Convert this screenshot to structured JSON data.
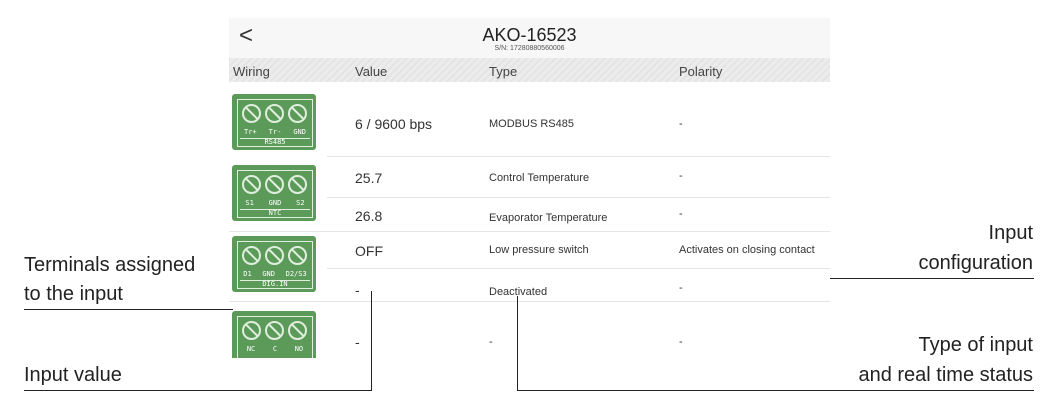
{
  "device": {
    "back_icon": "chevron-left-icon",
    "back_glyph": "<",
    "name": "AKO-16523",
    "serial": "S/N: 17280880560006"
  },
  "columns": [
    "Wiring",
    "Value",
    "Type",
    "Polarity"
  ],
  "terminals": [
    {
      "labels": [
        "Tr+",
        "Tr-",
        "GND"
      ],
      "name": "RS485"
    },
    {
      "labels": [
        "S1",
        "GND",
        "S2"
      ],
      "name": "NTC"
    },
    {
      "labels": [
        "D1",
        "GND",
        "D2/S3"
      ],
      "name": "DIG.IN"
    },
    {
      "labels": [
        "NC",
        "C",
        "NO"
      ],
      "name": ""
    }
  ],
  "rows": [
    {
      "value": "6 / 9600 bps",
      "type": "MODBUS RS485",
      "polarity": "-"
    },
    {
      "value": "25.7",
      "type": "Control Temperature",
      "polarity": "-"
    },
    {
      "value": "26.8",
      "type": "Evaporator Temperature",
      "polarity": "-"
    },
    {
      "value": "OFF",
      "type": "Low pressure switch",
      "polarity": "Activates on closing contact"
    },
    {
      "value": "-",
      "type": "Deactivated",
      "polarity": "-"
    },
    {
      "value": "-",
      "type": "-",
      "polarity": "-"
    }
  ],
  "annotations": {
    "terminals": [
      "Terminals assigned",
      "to the input"
    ],
    "input_value": "Input value",
    "input_config": [
      "Input",
      "configuration"
    ],
    "type_status": [
      "Type of input",
      "and real time status"
    ]
  }
}
